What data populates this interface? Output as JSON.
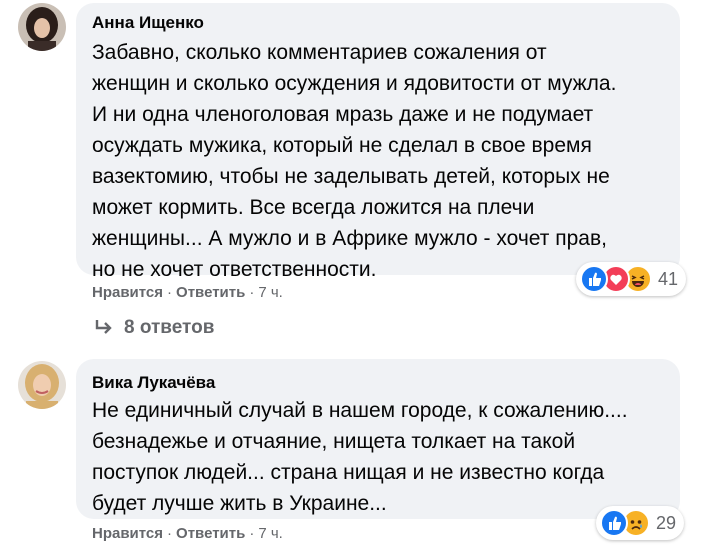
{
  "comments": [
    {
      "author": "Анна Ищенко",
      "lines": [
        "Забавно, сколько комментариев сожаления от",
        "женщин и сколько осуждения и ядовитости от мужла.",
        "И ни одна членоголовая мразь даже и не подумает",
        "осуждать мужика, который не сделал в свое время",
        "вазектомию, чтобы не заделывать детей, которых не",
        "может кормить. Все всегда ложится на плечи",
        "женщины... А мужло и в Африке мужло - хочет прав,",
        "но не хочет ответственности."
      ],
      "like_label": "Нравится",
      "reply_label": "Ответить",
      "separator": "·",
      "time": "7 ч.",
      "reaction_icons": [
        "like-icon",
        "love-icon",
        "haha-icon"
      ],
      "reaction_count": "41",
      "replies_label": "8 ответов"
    },
    {
      "author": "Вика Лукачёва",
      "lines": [
        "Не единичный случай в нашем городе, к сожалению....",
        "безнадежье и отчаяние, нищета толкает на такой",
        "поступок людей... страна нищая и не известно когда",
        "будет лучше жить в Украине..."
      ],
      "like_label": "Нравится",
      "reply_label": "Ответить",
      "separator": "·",
      "time": "7 ч.",
      "reaction_icons": [
        "like-icon",
        "sad-icon"
      ],
      "reaction_count": "29"
    }
  ],
  "colors": {
    "bubble": "#f0f2f5",
    "meta_text": "#65676b",
    "like_blue": "#1877f2",
    "love_red": "#f33e58",
    "emoji_yellow": "#f7b125"
  }
}
